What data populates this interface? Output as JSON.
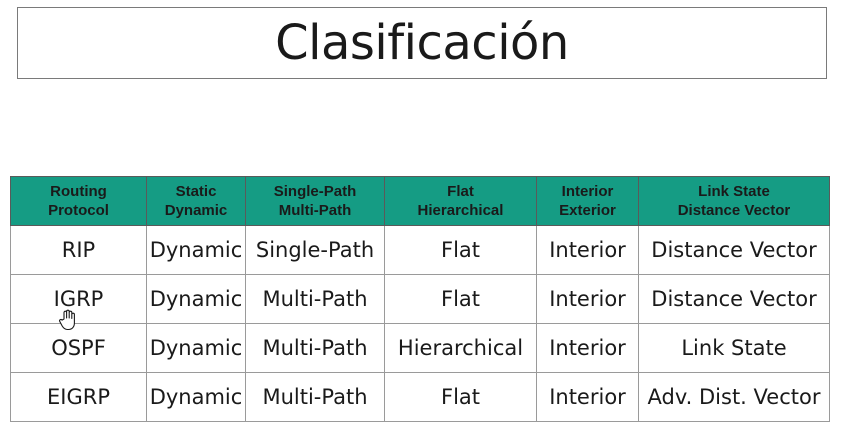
{
  "title": "Clasificación",
  "table": {
    "headers": [
      [
        "Routing",
        "Protocol"
      ],
      [
        "Static",
        "Dynamic"
      ],
      [
        "Single-Path",
        "Multi-Path"
      ],
      [
        "Flat",
        "Hierarchical"
      ],
      [
        "Interior",
        "Exterior"
      ],
      [
        "Link State",
        "Distance Vector"
      ]
    ],
    "rows": [
      [
        "RIP",
        "Dynamic",
        "Single-Path",
        "Flat",
        "Interior",
        "Distance Vector"
      ],
      [
        "IGRP",
        "Dynamic",
        "Multi-Path",
        "Flat",
        "Interior",
        "Distance Vector"
      ],
      [
        "OSPF",
        "Dynamic",
        "Multi-Path",
        "Hierarchical",
        "Interior",
        "Link State"
      ],
      [
        "EIGRP",
        "Dynamic",
        "Multi-Path",
        "Flat",
        "Interior",
        "Adv. Dist. Vector"
      ]
    ]
  },
  "colors": {
    "header_bg": "#159c84",
    "text": "#1a1a1a"
  },
  "cursor": "hand-cursor-icon"
}
